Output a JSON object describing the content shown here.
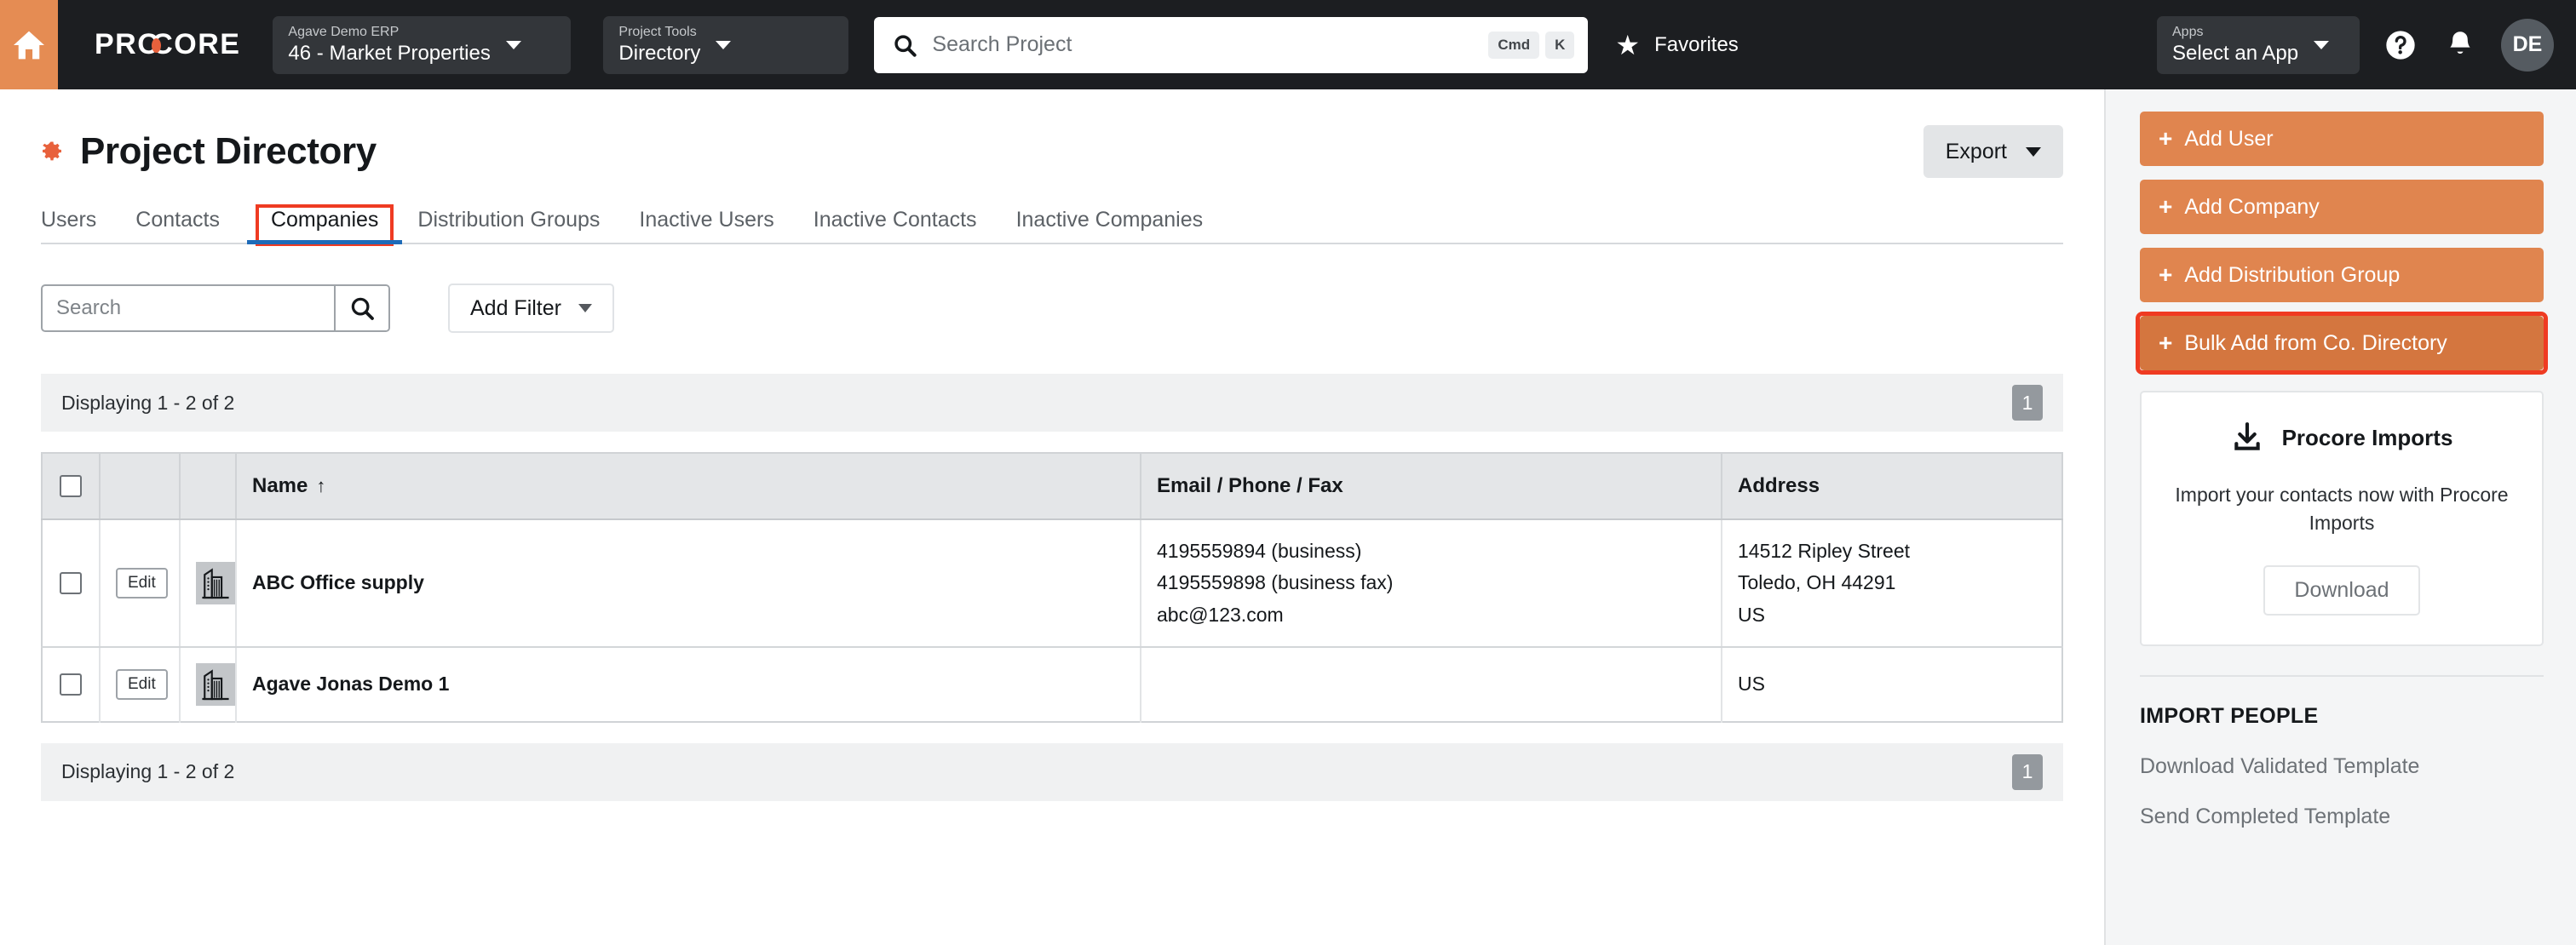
{
  "topnav": {
    "home_icon": "home-icon",
    "brand": "PROCORE",
    "project_select": {
      "label": "Agave Demo ERP",
      "value": "46 - Market Properties"
    },
    "tools_select": {
      "label": "Project Tools",
      "value": "Directory"
    },
    "search": {
      "placeholder": "Search Project",
      "kbd_cmd": "Cmd",
      "kbd_key": "K"
    },
    "favorites": "Favorites",
    "apps_select": {
      "label": "Apps",
      "value": "Select an App"
    },
    "help_icon": "help-circle-icon",
    "bell_icon": "notification-bell-icon",
    "avatar_initials": "DE"
  },
  "page": {
    "title": "Project Directory",
    "gear_icon": "gear-icon",
    "export_label": "Export"
  },
  "tabs": [
    {
      "label": "Users",
      "active": false
    },
    {
      "label": "Contacts",
      "active": false
    },
    {
      "label": "Companies",
      "active": true
    },
    {
      "label": "Distribution Groups",
      "active": false
    },
    {
      "label": "Inactive Users",
      "active": false
    },
    {
      "label": "Inactive Contacts",
      "active": false
    },
    {
      "label": "Inactive Companies",
      "active": false
    }
  ],
  "filters": {
    "search_placeholder": "Search",
    "search_value": "",
    "search_icon": "search-icon",
    "add_filter_label": "Add Filter"
  },
  "listing": {
    "displaying_top": "Displaying 1 - 2 of 2",
    "displaying_bottom": "Displaying 1 - 2 of 2",
    "page_number": "1"
  },
  "table": {
    "columns": [
      "",
      "",
      "",
      "Name",
      "Email / Phone / Fax",
      "Address"
    ],
    "sort_column": "Name",
    "sort_direction": "↑",
    "rows": [
      {
        "edit_label": "Edit",
        "logo_icon": "building-icon",
        "name": "ABC Office supply",
        "contact": [
          "4195559894 (business)",
          "4195559898 (business fax)",
          "abc@123.com"
        ],
        "address": [
          "14512 Ripley Street",
          "Toledo, OH 44291",
          "US"
        ]
      },
      {
        "edit_label": "Edit",
        "logo_icon": "building-icon",
        "name": "Agave Jonas Demo 1",
        "contact": [],
        "address": [
          "US"
        ]
      }
    ]
  },
  "sidebar": {
    "buttons": [
      {
        "label": "Add User",
        "highlighted": false,
        "annotated": false
      },
      {
        "label": "Add Company",
        "highlighted": false,
        "annotated": false
      },
      {
        "label": "Add Distribution Group",
        "highlighted": false,
        "annotated": false
      },
      {
        "label": "Bulk Add from Co. Directory",
        "highlighted": true,
        "annotated": true
      }
    ],
    "imports_card": {
      "icon": "download-icon",
      "title": "Procore Imports",
      "description": "Import your contacts now with Procore Imports",
      "button_label": "Download"
    },
    "import_people": {
      "title": "IMPORT PEOPLE",
      "links": [
        "Download Validated Template",
        "Send Completed Template"
      ]
    }
  },
  "colors": {
    "brand_orange": "#e58c53",
    "nav_dark": "#1c1e21",
    "accent_button": "#e0854f",
    "accent_button_hover": "#d4763f",
    "annotation_red": "#ef3b22",
    "active_tab_blue": "#1e6bb8"
  }
}
